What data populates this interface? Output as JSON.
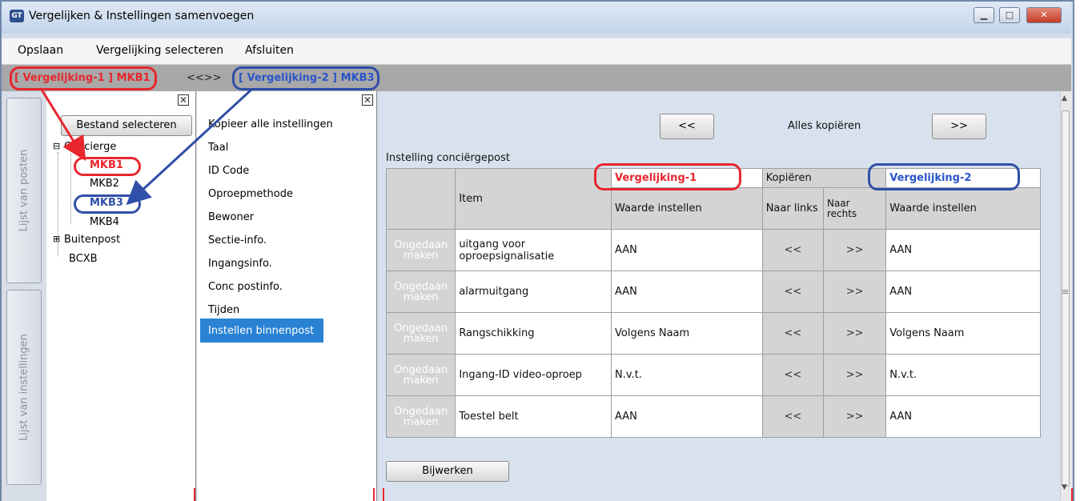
{
  "window": {
    "app_icon": "GT",
    "title": "Vergelijken & Instellingen samenvoegen",
    "controls": {
      "minimize": "▁",
      "maximize": "□",
      "close": "✕"
    }
  },
  "menu": {
    "save": "Opslaan",
    "select": "Vergelijking selecteren",
    "close": "Afsluiten"
  },
  "tabs": {
    "v1": "[ Vergelijking-1 ] MKB1",
    "nav": "<<>>",
    "v2": "[ Vergelijking-2 ] MKB3"
  },
  "sidebar": {
    "posts_tab": "Lijst van posten",
    "settings_tab": "Lijst van instellingen"
  },
  "tree": {
    "select_button": "Bestand selecteren",
    "concierge": "Concierge",
    "mkb1": "MKB1",
    "mkb2": "MKB2",
    "mkb3": "MKB3",
    "mkb4": "MKB4",
    "outdoor": "Buitenpost",
    "bcxb": "BCXB",
    "expand": "⊟",
    "collapse": "⊞"
  },
  "list": {
    "items": [
      "Kopieer alle instellingen",
      "Taal",
      "ID Code",
      "Oproepmethode",
      "Bewoner",
      "Sectie-info.",
      "Ingangsinfo.",
      "Conc postinfo.",
      "Tijden",
      "Instellen binnenpost"
    ]
  },
  "main": {
    "copy_left": "<<",
    "copy_all": "Alles kopiëren",
    "copy_right": ">>",
    "section_title": "Instelling conciërgepost",
    "col_item": "Item",
    "col_v1": "Vergelijking-1",
    "col_copy": "Kopiëren",
    "col_v2": "Vergelijking-2",
    "col_v1_sub": "Waarde instellen",
    "col_left": "Naar links",
    "col_right": "Naar rechts",
    "col_v2_sub": "Waarde instellen",
    "rows": [
      {
        "undo": "Ongedaan maken",
        "item": "uitgang voor oproepsignalisatie",
        "v1": "AAN",
        "left": "<<",
        "right": ">>",
        "v2": "AAN"
      },
      {
        "undo": "Ongedaan maken",
        "item": "alarmuitgang",
        "v1": "AAN",
        "left": "<<",
        "right": ">>",
        "v2": "AAN"
      },
      {
        "undo": "Ongedaan maken",
        "item": "Rangschikking",
        "v1": "Volgens Naam",
        "left": "<<",
        "right": ">>",
        "v2": "Volgens Naam"
      },
      {
        "undo": "Ongedaan maken",
        "item": "Ingang-ID video-oproep",
        "v1": "N.v.t.",
        "left": "<<",
        "right": ">>",
        "v2": "N.v.t."
      },
      {
        "undo": "Ongedaan maken",
        "item": "Toestel belt",
        "v1": "AAN",
        "left": "<<",
        "right": ">>",
        "v2": "AAN"
      }
    ],
    "update_button": "Bijwerken"
  },
  "scroll": {
    "up": "▲",
    "down": "▼",
    "grip": "≡"
  },
  "colors": {
    "highlight_red": "#e8262e",
    "highlight_blue": "#2f4fa8",
    "selection": "#2a82d4"
  }
}
